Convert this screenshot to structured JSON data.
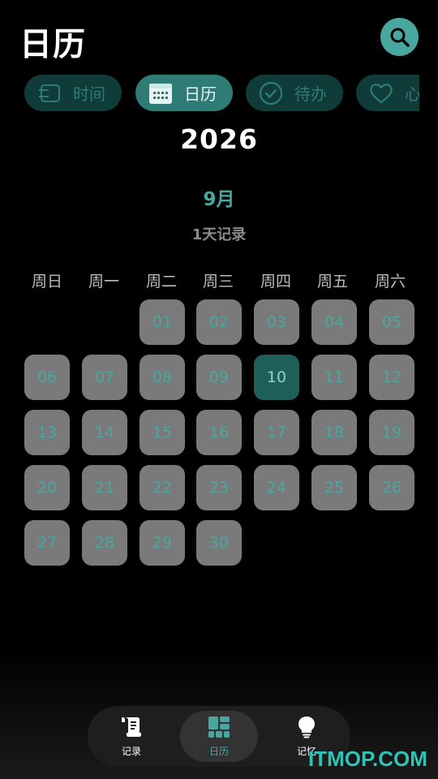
{
  "header": {
    "title": "日历",
    "search_icon": "search-icon",
    "accent": "#4aa7a0"
  },
  "tabs": [
    {
      "label": "时间",
      "icon": "timeline-icon",
      "active": false
    },
    {
      "label": "日历",
      "icon": "calendar-icon",
      "active": true
    },
    {
      "label": "待办",
      "icon": "check-circle-icon",
      "active": false
    },
    {
      "label": "心",
      "icon": "heart-icon",
      "active": false
    }
  ],
  "calendar": {
    "year": "2026",
    "month": "9月",
    "record_count": "1天记录",
    "weekdays": [
      "周日",
      "周一",
      "周二",
      "周三",
      "周四",
      "周五",
      "周六"
    ],
    "first_weekday": 2,
    "days": [
      "01",
      "02",
      "03",
      "04",
      "05",
      "06",
      "07",
      "08",
      "09",
      "10",
      "11",
      "12",
      "13",
      "14",
      "15",
      "16",
      "17",
      "18",
      "19",
      "20",
      "21",
      "22",
      "23",
      "24",
      "25",
      "26",
      "27",
      "28",
      "29",
      "30"
    ],
    "selected_day": "10"
  },
  "bottom_nav": [
    {
      "label": "记录",
      "icon": "scroll-icon",
      "active": false
    },
    {
      "label": "日历",
      "icon": "grid-icon",
      "active": true
    },
    {
      "label": "记忆",
      "icon": "lightbulb-icon",
      "active": false
    }
  ],
  "watermark": "ITMOP.COM"
}
